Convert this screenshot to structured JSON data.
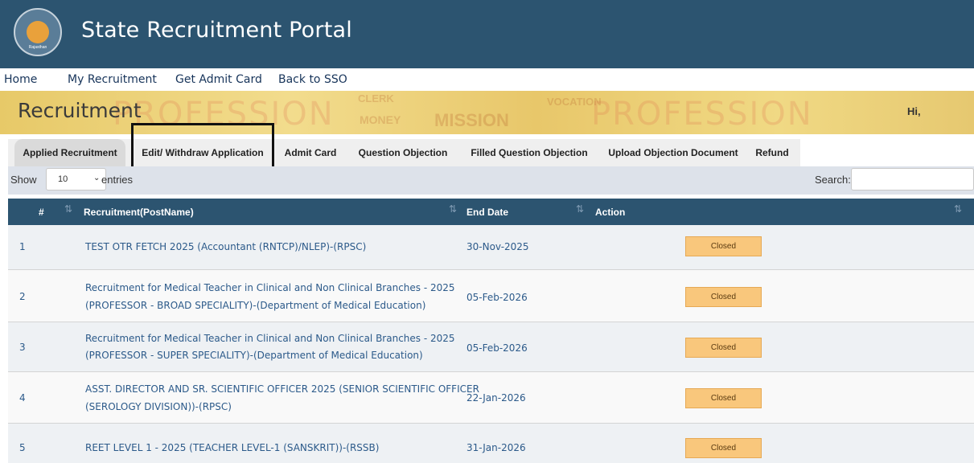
{
  "header": {
    "title": "State Recruitment Portal",
    "logo_caption": "Rajasthan",
    "bg_color": "#2c5470"
  },
  "nav": {
    "items": [
      "Home",
      "My Recruitment",
      "Get Admit Card",
      "Back to SSO"
    ]
  },
  "banner": {
    "title": "Recruitment",
    "greeting": "Hi,"
  },
  "tabs": [
    {
      "label": "Applied Recruitment",
      "active": true
    },
    {
      "label": "Edit/ Withdraw Application",
      "active": false
    },
    {
      "label": "Admit Card",
      "active": false
    },
    {
      "label": "Question Objection",
      "active": false
    },
    {
      "label": "Filled Question Objection",
      "active": false
    },
    {
      "label": "Upload Objection Document",
      "active": false
    },
    {
      "label": "Refund",
      "active": false
    }
  ],
  "table_controls": {
    "show_label": "Show",
    "entries_value": "10",
    "entries_label": "entries",
    "search_label": "Search:",
    "search_value": ""
  },
  "table": {
    "columns": [
      "#",
      "Recruitment(PostName)",
      "End Date",
      "Action"
    ],
    "rows": [
      {
        "num": "1",
        "line1": "TEST OTR FETCH 2025 (Accountant (RNTCP)/NLEP)-(RPSC)",
        "line2": "",
        "end_date": "30-Nov-2025",
        "action": "Closed"
      },
      {
        "num": "2",
        "line1": "Recruitment for Medical Teacher in Clinical and Non Clinical Branches - 2025",
        "line2": "(PROFESSOR - BROAD SPECIALITY)-(Department of Medical Education)",
        "end_date": "05-Feb-2026",
        "action": "Closed"
      },
      {
        "num": "3",
        "line1": "Recruitment for Medical Teacher in Clinical and Non Clinical Branches - 2025",
        "line2": "(PROFESSOR - SUPER SPECIALITY)-(Department of Medical Education)",
        "end_date": "05-Feb-2026",
        "action": "Closed"
      },
      {
        "num": "4",
        "line1": "ASST. DIRECTOR AND SR. SCIENTIFIC OFFICER 2025 (SENIOR SCIENTIFIC OFFICER",
        "line2": "(SEROLOGY DIVISION))-(RPSC)",
        "end_date": "22-Jan-2026",
        "action": "Closed"
      },
      {
        "num": "5",
        "line1": "REET LEVEL 1 - 2025 (TEACHER LEVEL-1 (SANSKRIT))-(RSSB)",
        "line2": "",
        "end_date": "31-Jan-2026",
        "action": "Closed"
      }
    ]
  },
  "colors": {
    "primary": "#2c5470",
    "link": "#2c5a8a",
    "closed_button": "#f9c77c"
  }
}
